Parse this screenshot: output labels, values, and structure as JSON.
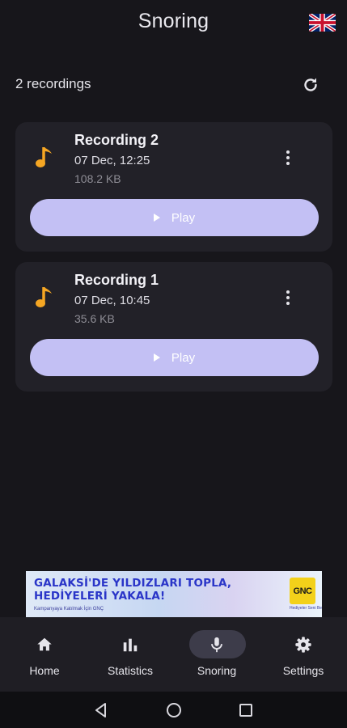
{
  "app": {
    "title": "Snoring",
    "language_icon": "uk-flag-icon"
  },
  "summary": {
    "count_text": "2 recordings",
    "refresh_icon": "refresh-icon"
  },
  "recordings": [
    {
      "title": "Recording 2",
      "date": "07 Dec, 12:25",
      "size": "108.2 KB",
      "play_label": "Play"
    },
    {
      "title": "Recording 1",
      "date": "07 Dec, 10:45",
      "size": "35.6 KB",
      "play_label": "Play"
    }
  ],
  "ad": {
    "line1": "GALAKSİ'DE YILDIZLARI TOPLA,",
    "line2": "HEDİYELERİ YAKALA!",
    "small": "Kampanyaya Katılmak İçin GNÇ",
    "logo": "GNC",
    "logo_sub": "Hediyeler Seni Bekliyor"
  },
  "nav": {
    "items": [
      {
        "label": "Home",
        "icon": "home-icon"
      },
      {
        "label": "Statistics",
        "icon": "bar-chart-icon"
      },
      {
        "label": "Snoring",
        "icon": "microphone-icon",
        "active": true
      },
      {
        "label": "Settings",
        "icon": "gear-icon"
      }
    ]
  },
  "colors": {
    "background": "#17161b",
    "card": "#222128",
    "accent_play": "#c3c0f4",
    "music_icon": "#f5a623",
    "nav_active_pill": "#3d3c4a"
  }
}
